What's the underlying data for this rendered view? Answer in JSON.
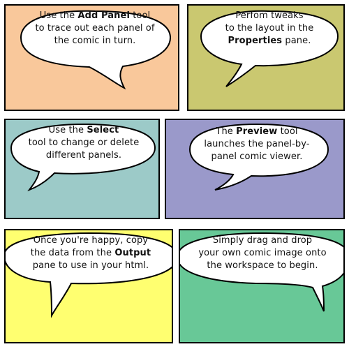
{
  "colors": {
    "panel1": "#f9c89b",
    "panel2": "#cac870",
    "panel3": "#9ccac8",
    "panel4": "#9a99ca",
    "panel5": "#ffff70",
    "panel6": "#68c897",
    "outline": "#000000",
    "bubble": "#ffffff"
  },
  "panels": [
    {
      "line1_pre": "Use the ",
      "line1_bold": "Add Panel",
      "line1_post": " tool",
      "line2": "to trace out each panel of",
      "line3": "the comic in turn."
    },
    {
      "line1": "Perfom tweaks",
      "line2": "to the layout in the",
      "line3_bold": "Properties",
      "line3_post": " pane."
    },
    {
      "line1_pre": "Use the ",
      "line1_bold": "Select",
      "line2": "tool to change or delete",
      "line3": "different panels."
    },
    {
      "line1_pre": "The ",
      "line1_bold": "Preview",
      "line1_post": " tool",
      "line2": "launches the panel-by-",
      "line3": "panel comic viewer."
    },
    {
      "line1": "Once you're happy, copy",
      "line2_pre": "the data from the ",
      "line2_bold": "Output",
      "line3": "pane to use in your html."
    },
    {
      "line1": "Simply drag and drop",
      "line2": "your own comic image onto",
      "line3": "the workspace to begin."
    }
  ]
}
